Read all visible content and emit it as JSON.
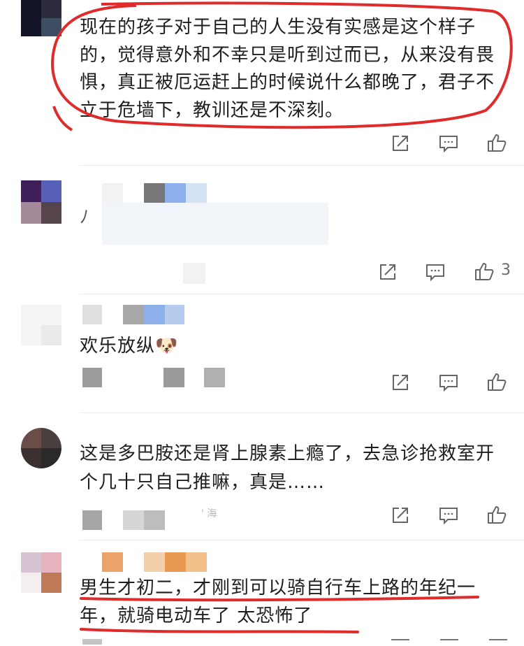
{
  "comments": [
    {
      "lines": [
        "现在的孩子对于自己的人生没有实感是这个样子",
        "的，觉得意外和不幸只是听到过而已，从来没有畏",
        "惧，真正被厄运赶上的时候说什么都晚了，君子不",
        "立于危墙下，教训还是不深刻。"
      ],
      "likes": ""
    },
    {
      "lines": [
        "ﾉ"
      ],
      "likes": "3"
    },
    {
      "lines": [
        "欢乐放纵🐶"
      ],
      "likes": ""
    },
    {
      "lines": [
        "这是多巴胺还是肾上腺素上瘾了，去急诊抢救室开",
        "个几十只自己推嘛，真是……"
      ],
      "likes": "",
      "meta_fragment": "' 海"
    },
    {
      "lines": [
        "男生才初二，才刚到可以骑自行车上路的年纪一",
        "年，就骑电动车了       太恐怖了"
      ],
      "likes": ""
    }
  ],
  "icons": [
    "share-icon",
    "comment-icon",
    "like-icon"
  ],
  "colors": {
    "annotation": "#e02b2b",
    "text": "#1e1e1e",
    "icon": "#666666",
    "separator": "#ececec"
  }
}
